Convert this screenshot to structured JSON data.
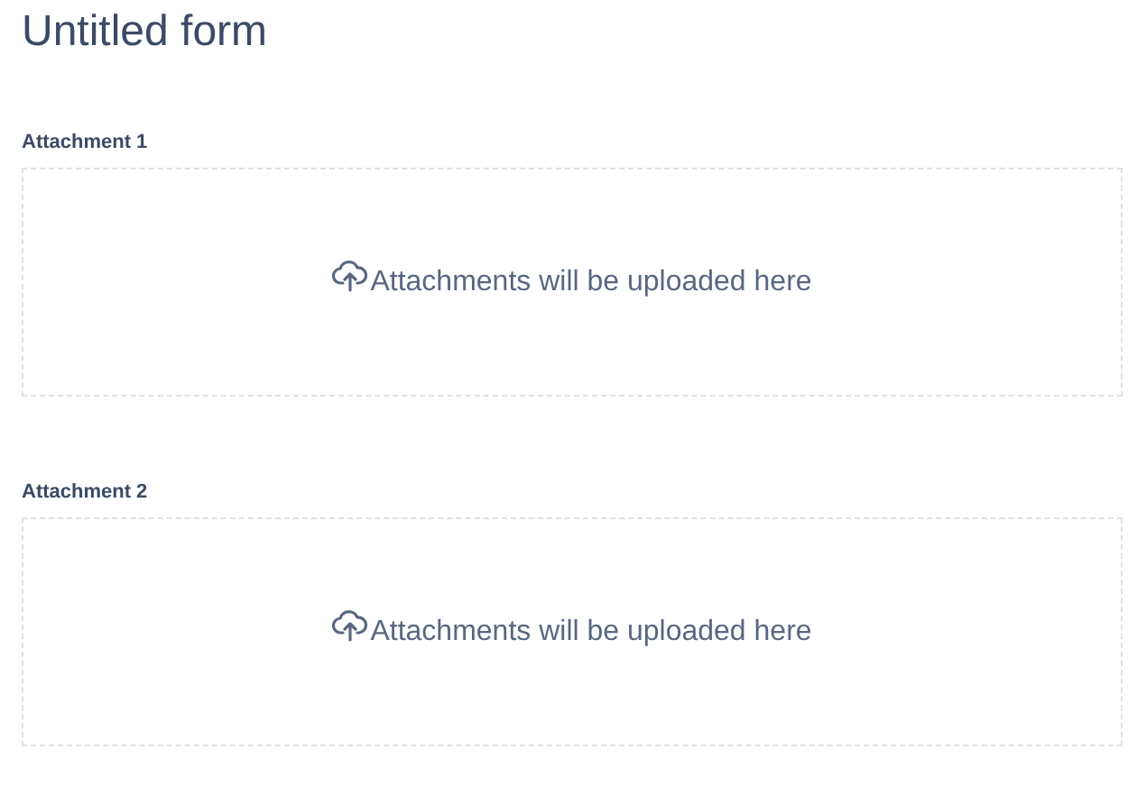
{
  "title": "Untitled form",
  "fields": [
    {
      "label": "Attachment 1",
      "hint": "Attachments will be uploaded here"
    },
    {
      "label": "Attachment 2",
      "hint": "Attachments will be uploaded here"
    }
  ]
}
